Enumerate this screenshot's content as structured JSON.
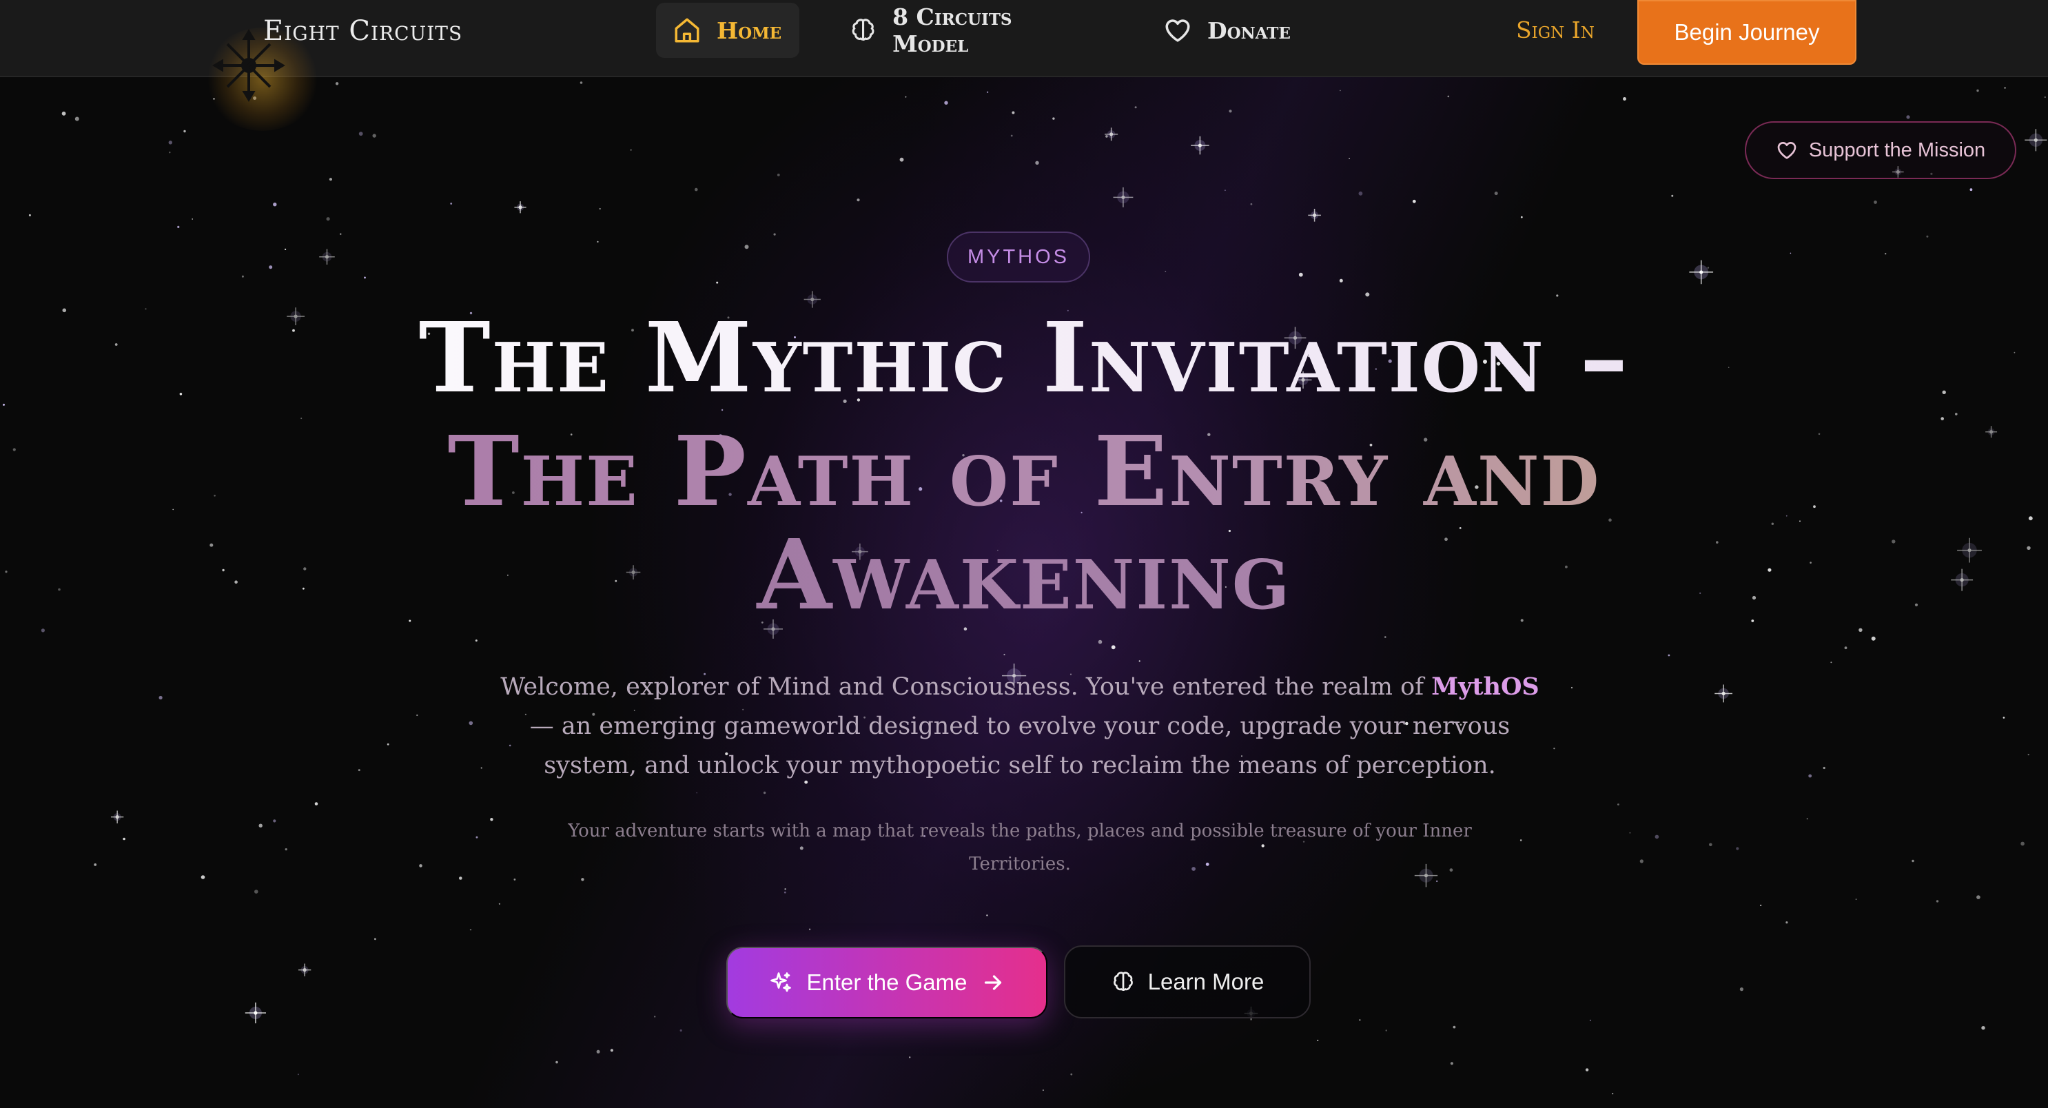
{
  "brand": {
    "name": "Eight Circuits",
    "icon": "chaos-star-icon"
  },
  "nav": {
    "items": [
      {
        "label": "Home",
        "icon": "home-icon",
        "active": true
      },
      {
        "label": "8 Circuits Model",
        "icon": "brain-icon",
        "active": false
      },
      {
        "label": "Donate",
        "icon": "heart-icon",
        "active": false
      }
    ],
    "sign_in": "Sign In",
    "cta": "Begin Journey"
  },
  "support": {
    "label": "Support the Mission",
    "icon": "heart-icon"
  },
  "hero": {
    "badge": "MYTHOS",
    "title_line1": "The Mythic Invitation –",
    "title_line2": "The Path of Entry and",
    "title_line3": "Awakening",
    "intro_before": "Welcome, explorer of Mind and Consciousness. You've entered the realm of",
    "intro_highlight": "MythOS",
    "intro_after": "— an emerging gameworld designed to evolve your code, upgrade your nervous system, and unlock your mythopoetic self to reclaim the means of perception.",
    "subtext": "Your adventure starts with a map that reveals the paths, places and possible treasure of your Inner Territories.",
    "primary_button": {
      "label": "Enter the Game",
      "icon": "sparkles-icon",
      "trailing_icon": "arrow-right-icon"
    },
    "secondary_button": {
      "label": "Learn More",
      "icon": "brain-icon"
    }
  },
  "colors": {
    "accent_gold": "#f5b834",
    "accent_orange": "#e8721a",
    "accent_purple": "#a23be0",
    "accent_pink": "#e52f8c",
    "highlight": "#dc9ce8"
  }
}
